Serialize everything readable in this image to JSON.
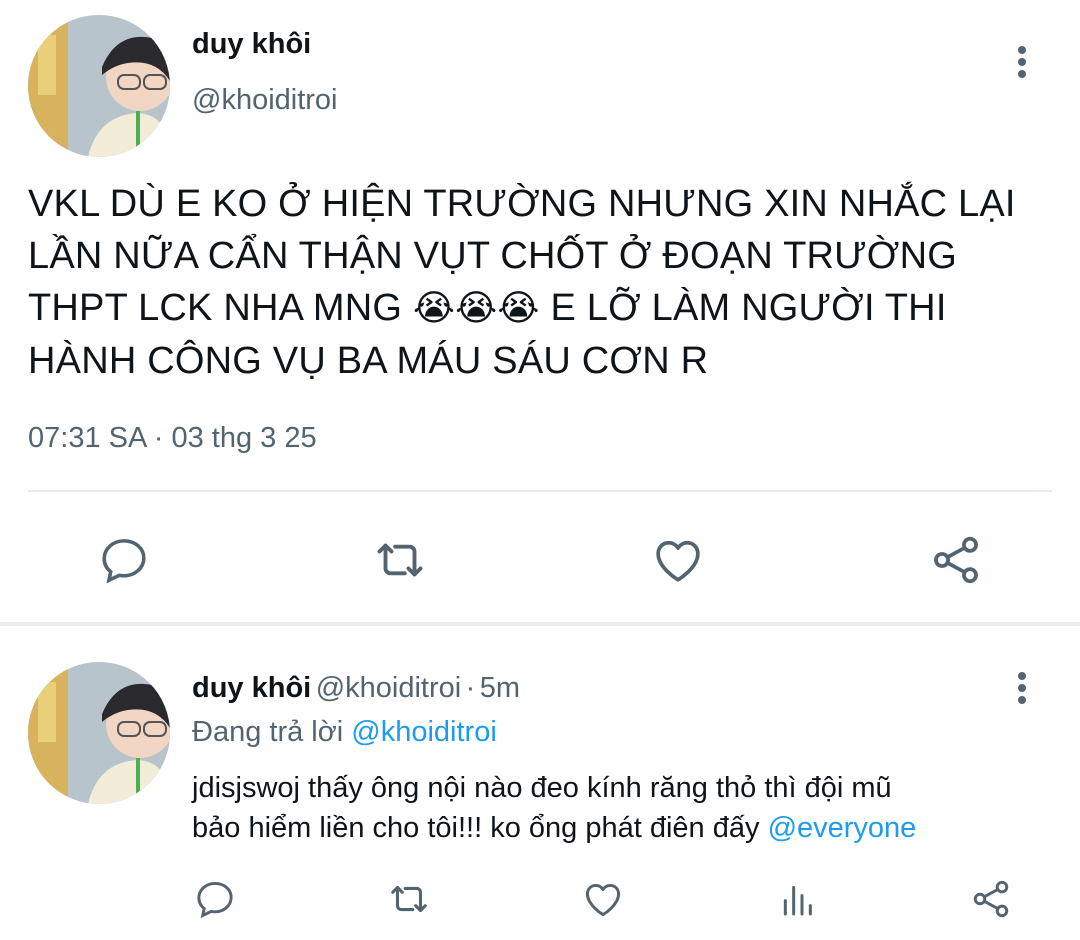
{
  "main_tweet": {
    "author_name": "duy khôi",
    "author_handle": "@khoiditroi",
    "text_line1": "VKL DÙ E KO Ở HIỆN TRƯỜNG NHƯNG XIN NHẮC LẠI",
    "text_line2": "LẦN NỮA CẨN THẬN VỤT CHỐT Ở ĐOẠN TRƯỜNG",
    "text_line3_a": "THPT LCK NHA MNG",
    "text_line3_emoji": "😭😭😭",
    "text_line3_b": "E LỠ LÀM NGƯỜI THI",
    "text_line4": "HÀNH CÔNG VỤ BA MÁU SÁU CƠN R",
    "timestamp": "07:31 SA · 03 thg 3 25"
  },
  "reply_tweet": {
    "author_name": "duy khôi",
    "author_handle": "@khoiditroi",
    "separator": "·",
    "time_ago": "5m",
    "replying_prefix": "Đang trả lời",
    "replying_to": "@khoiditroi",
    "text_line1": "jdisjswoj thấy ông nội nào đeo kính răng thỏ thì đội mũ",
    "text_line2": "bảo hiểm liền cho tôi!!! ko ổng phát điên đấy",
    "mention": "@everyone"
  },
  "icons": {
    "more": "more-vertical-icon",
    "reply": "reply-icon",
    "retweet": "retweet-icon",
    "like": "like-icon",
    "analytics": "analytics-icon",
    "share": "share-icon"
  },
  "colors": {
    "text": "#0f1419",
    "secondary": "#536471",
    "link": "#1d9bf0",
    "divider": "#e6ecf0"
  }
}
